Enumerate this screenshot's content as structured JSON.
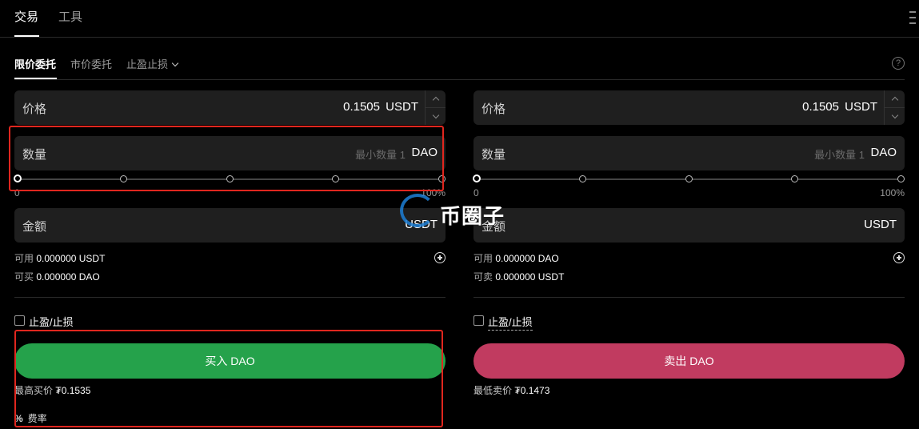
{
  "top_tabs": [
    "交易",
    "工具"
  ],
  "order_tabs": {
    "limit": "限价委托",
    "market": "市价委托",
    "tpsl": "止盈止损"
  },
  "buy": {
    "price_label": "价格",
    "price_value": "0.1505",
    "price_unit": "USDT",
    "qty_label": "数量",
    "qty_placeholder": "最小数量 1",
    "qty_unit": "DAO",
    "slider_min": "0",
    "slider_max": "100%",
    "amount_label": "金额",
    "amount_unit": "USDT",
    "avail_label": "可用",
    "avail_value": "0.000000 USDT",
    "can_label": "可买",
    "can_value": "0.000000 DAO",
    "tpsl_label": "止盈/止损",
    "button": "买入 DAO",
    "best_label": "最高买价",
    "best_value": "₮0.1535",
    "fee_icon": "%",
    "fee_label": "费率"
  },
  "sell": {
    "price_label": "价格",
    "price_value": "0.1505",
    "price_unit": "USDT",
    "qty_label": "数量",
    "qty_placeholder": "最小数量 1",
    "qty_unit": "DAO",
    "slider_min": "0",
    "slider_max": "100%",
    "amount_label": "金额",
    "amount_unit": "USDT",
    "avail_label": "可用",
    "avail_value": "0.000000 DAO",
    "can_label": "可卖",
    "can_value": "0.000000 USDT",
    "tpsl_label": "止盈/止损",
    "button": "卖出 DAO",
    "best_label": "最低卖价",
    "best_value": "₮0.1473"
  },
  "watermark": "币圈子",
  "colors": {
    "buy": "#25a24b",
    "sell": "#c13b60",
    "highlight": "#e0261e"
  }
}
